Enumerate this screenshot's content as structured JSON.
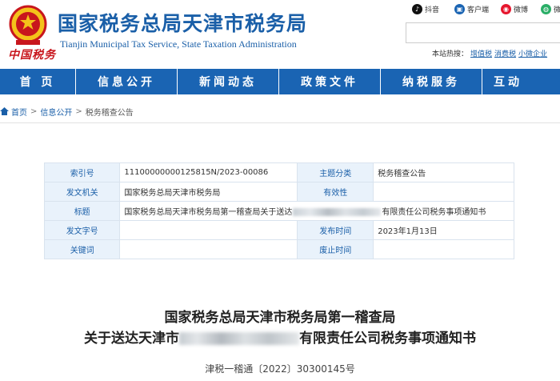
{
  "header": {
    "title": "国家税务总局天津市税务局",
    "subtitle": "Tianjin Municipal Tax Service, State Taxation Administration",
    "logo_script": "中国税务"
  },
  "social": [
    {
      "label": "抖音",
      "icon": "tiktok-icon",
      "color": "#111111"
    },
    {
      "label": "客户端",
      "icon": "app-client-icon",
      "color": "#1a64b3"
    },
    {
      "label": "微博",
      "icon": "weibo-icon",
      "color": "#e6162d"
    },
    {
      "label": "微信",
      "icon": "wechat-icon",
      "color": "#2aae67"
    }
  ],
  "search": {
    "hot_label": "本站热搜：",
    "hot_links": [
      "增值税",
      "消费税",
      "小微企业"
    ]
  },
  "nav": [
    "首 页",
    "信息公开",
    "新闻动态",
    "政策文件",
    "纳税服务",
    "互动"
  ],
  "breadcrumb": {
    "home": "首页",
    "sep": ">",
    "level1": "信息公开",
    "level2": "税务稽查公告"
  },
  "info": {
    "index_label": "索引号",
    "index_value": "11100000000125815N/2023-00086",
    "topic_label": "主题分类",
    "topic_value": "税务稽查公告",
    "issuer_label": "发文机关",
    "issuer_value": "国家税务总局天津市税务局",
    "validity_label": "有效性",
    "validity_value": "",
    "title_label": "标题",
    "title_prefix": "国家税务总局天津市税务局第一稽查局关于送达",
    "title_suffix": "有限责任公司税务事项通知书",
    "docno_label": "发文字号",
    "docno_value": "",
    "date_label": "发布时间",
    "date_value": "2023年1月13日",
    "keywords_label": "关键词",
    "keywords_value": "",
    "repeal_label": "废止时间",
    "repeal_value": ""
  },
  "doc": {
    "title_line1": "国家税务总局天津市税务局第一稽查局",
    "title_line2_prefix": "关于送达天津市",
    "title_line2_suffix": "有限责任公司税务事项通知书",
    "number": "津税一稽通〔2022〕30300145号"
  }
}
